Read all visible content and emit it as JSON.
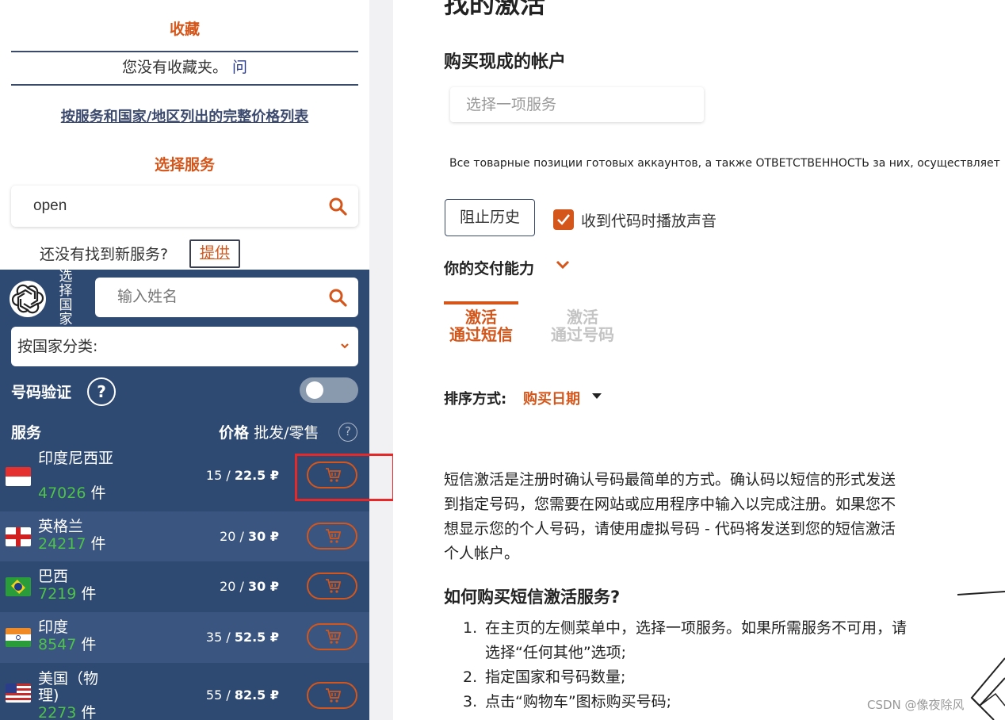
{
  "sidebar": {
    "favorites_title": "收藏",
    "favorites_empty": "您没有收藏夹。",
    "favorites_question": "问",
    "price_list_link": "按服务和国家/地区列出的完整价格列表",
    "select_service_title": "选择服务",
    "search_value": "open",
    "not_found_text": "还没有找到新服务?",
    "offer_label": "提供",
    "select_country_label": "选择国家",
    "name_placeholder": "输入姓名",
    "sort_by_country": "按国家分类:",
    "number_verify_label": "号码验证",
    "help_label": "?",
    "col_service": "服务",
    "col_price": "价格",
    "col_price_sub": "批发/零售",
    "col_help": "?",
    "unit": "件",
    "countries": [
      {
        "name": "印度尼西亚",
        "count": "47026",
        "wholesale": "15",
        "retail": "22.5 ₽"
      },
      {
        "name": "英格兰",
        "count": "24217",
        "wholesale": "20",
        "retail": "30 ₽"
      },
      {
        "name": "巴西",
        "count": "7219",
        "wholesale": "20",
        "retail": "30 ₽"
      },
      {
        "name": "印度",
        "count": "8547",
        "wholesale": "35",
        "retail": "52.5 ₽"
      },
      {
        "name": "美国（物理)",
        "count": "2273",
        "wholesale": "55",
        "retail": "82.5 ₽"
      }
    ]
  },
  "main": {
    "page_title": "找的激活",
    "buy_ready_title": "购买现成的帐户",
    "service_select_placeholder": "选择一项服务",
    "notice": "Все товарные позиции готовых аккаунтов, а также ОТВЕТСТВЕННОСТЬ за них, осуществляет",
    "block_history_label": "阻止历史",
    "sound_checkbox_label": "收到代码时播放声音",
    "sound_checked": true,
    "delivery_label": "你的交付能力",
    "tabs": [
      {
        "line1": "激活",
        "line2": "通过短信",
        "active": true
      },
      {
        "line1": "激活",
        "line2": "通过号码",
        "active": false
      }
    ],
    "sort_label": "排序方式:",
    "sort_value": "购买日期",
    "description": "短信激活是注册时确认号码最简单的方式。确认码以短信的形式发送到指定号码，您需要在网站或应用程序中输入以完成注册。如果您不想显示您的个人号码，请使用虚拟号码 - 代码将发送到您的短信激活个人帐户。",
    "howto_title": "如何购买短信激活服务?",
    "steps": [
      "在主页的左侧菜单中，选择一项服务。如果所需服务不可用，请选择“任何其他”选项;",
      "指定国家和号码数量;",
      "点击“购物车”图标购买号码;"
    ]
  },
  "watermark": "CSDN @像夜除风",
  "colors": {
    "accent": "#d4561a",
    "sidebar_dark": "#2f4a72",
    "count_green": "#4ec24a",
    "highlight_red": "#e62828"
  }
}
